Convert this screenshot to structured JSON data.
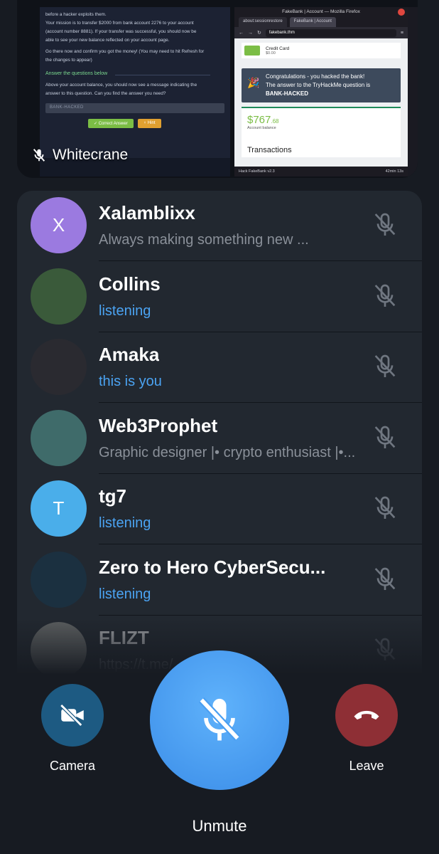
{
  "shared_screen": {
    "presenter_name": "Whitecrane",
    "doc": {
      "lines": [
        "before a hacker exploits them.",
        "Your mission is to transfer $2000 from bank account 2276 to your account",
        "(account number 8881). If your transfer was successful, you should now be",
        "able to see your new balance reflected on your account page.",
        "Go there now and confirm you got the money! (You may need to hit Refresh for",
        "the changes to appear)"
      ],
      "section_title": "Answer the questions below",
      "question_lines": [
        "Above your account balance, you should now see a message indicating the",
        "answer to this question. Can you find the answer you need?"
      ],
      "answer_value": "BANK-HACKED",
      "correct_button": "✓ Correct Answer",
      "hint_button": "♀ Hint"
    },
    "browser": {
      "window_title": "FakeBank | Account — Mozilla Firefox",
      "tab_1": "about:sessionrestore",
      "tab_2": "FakeBank | Account",
      "url": "fakebank.thm",
      "card_title": "Credit Card",
      "card_amount": "$0.00",
      "congrats_line_1": "Congratulations - you hacked the bank!",
      "congrats_line_2": "The answer to the TryHackMe question is",
      "congrats_answer": "BANK-HACKED",
      "balance_main": "$767",
      "balance_cents": ".68",
      "balance_label": "Account balance",
      "transactions_label": "Transactions",
      "status_left": "Hack FakeBank v2.3",
      "status_right": "42min 13s"
    }
  },
  "participants": [
    {
      "name": "Xalamblixx",
      "status": "Always making something new ...",
      "status_type": "bio",
      "avatar_letter": "X",
      "avatar_color": "#9b7ae0",
      "muted": true
    },
    {
      "name": "Collins",
      "status": "listening",
      "status_type": "blue",
      "avatar_letter": "",
      "avatar_color": "#3a5a3a",
      "muted": true
    },
    {
      "name": "Amaka",
      "status": "this is you",
      "status_type": "blue",
      "avatar_letter": "",
      "avatar_color": "#2a2a30",
      "muted": true
    },
    {
      "name": "Web3Prophet",
      "status": "Graphic designer |• crypto enthusiast |•...",
      "status_type": "bio",
      "avatar_letter": "",
      "avatar_color": "#3f6b6a",
      "muted": true
    },
    {
      "name": "tg7",
      "status": "listening",
      "status_type": "blue",
      "avatar_letter": "T",
      "avatar_color": "#4aaeea",
      "muted": true
    },
    {
      "name": "Zero to Hero CyberSecu...",
      "status": "listening",
      "status_type": "blue",
      "avatar_letter": "",
      "avatar_color": "#1b3040",
      "muted": true
    },
    {
      "name": "FLIZT",
      "status": "https://t.me/...",
      "status_type": "bio",
      "avatar_letter": "",
      "avatar_color": "#8a8a86",
      "muted": true
    }
  ],
  "controls": {
    "camera_label": "Camera",
    "unmute_label": "Unmute",
    "leave_label": "Leave"
  },
  "colors": {
    "background": "#171b22",
    "panel": "#222830",
    "status_blue": "#4ba3f2",
    "camera": "#1d5a82",
    "leave": "#8e2f35",
    "unmute": "#4a9ff2"
  }
}
